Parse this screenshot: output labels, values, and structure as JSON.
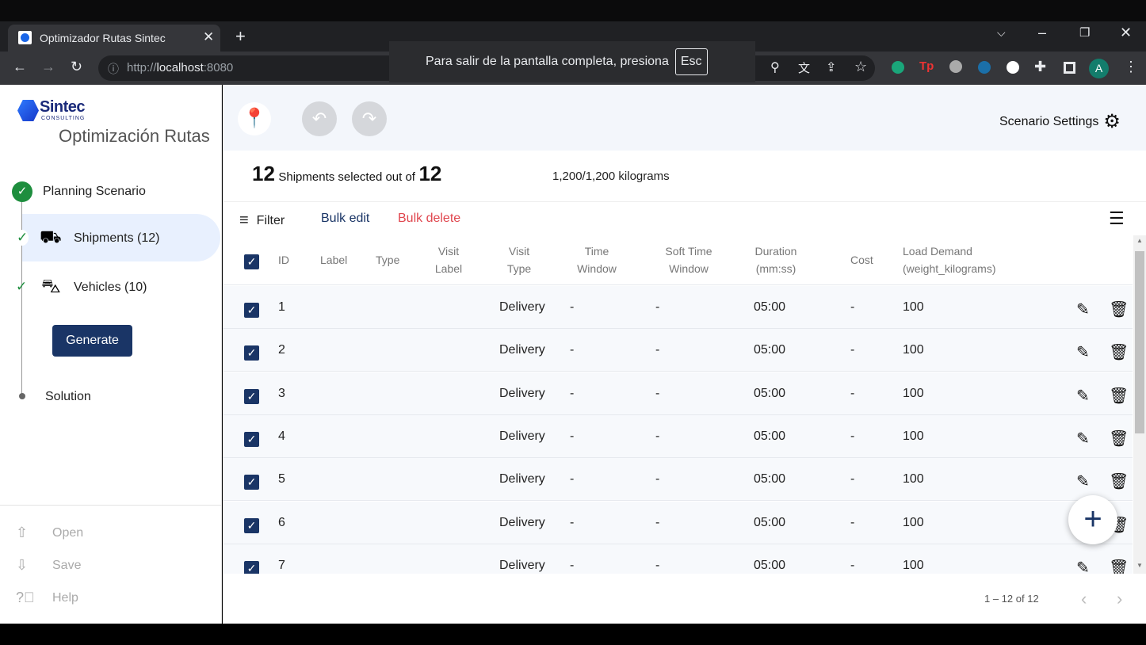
{
  "browser": {
    "tab_title": "Optimizador Rutas Sintec",
    "url_prefix": "http://",
    "url_host": "localhost",
    "url_port": ":8080",
    "fullscreen_note": "Para salir de la pantalla completa, presiona",
    "esc_key": "Esc",
    "profile_initial": "A"
  },
  "sidebar": {
    "brand": "Sintec",
    "brand_sub": "CONSULTING",
    "app_title": "Optimización Rutas",
    "steps": [
      {
        "label": "Planning Scenario"
      },
      {
        "label": "Shipments (12)"
      },
      {
        "label": "Vehicles (10)"
      },
      {
        "label": "Solution"
      }
    ],
    "generate": "Generate",
    "footer": [
      {
        "label": "Open"
      },
      {
        "label": "Save"
      },
      {
        "label": "Help"
      }
    ]
  },
  "header": {
    "scenario_settings": "Scenario Settings"
  },
  "summary": {
    "selected": "12",
    "selected_text": "Shipments selected out of",
    "total": "12",
    "weight": "1,200/1,200 kilograms"
  },
  "toolbar": {
    "filter": "Filter",
    "bulk_edit": "Bulk edit",
    "bulk_delete": "Bulk delete",
    "bulk_delete_color": "#e0474f"
  },
  "table": {
    "columns": [
      {
        "l1": "ID"
      },
      {
        "l1": "Label"
      },
      {
        "l1": "Type"
      },
      {
        "l1": "Visit",
        "l2": "Label"
      },
      {
        "l1": "Visit",
        "l2": "Type"
      },
      {
        "l1": "Time",
        "l2": "Window"
      },
      {
        "l1": "Soft Time",
        "l2": "Window"
      },
      {
        "l1": "Duration",
        "l2": "(mm:ss)"
      },
      {
        "l1": "Cost"
      },
      {
        "l1": "Load Demand",
        "l2": "(weight_kilograms)"
      }
    ],
    "rows": [
      {
        "id": "1",
        "visit_type": "Delivery",
        "tw": "-",
        "stw": "-",
        "duration": "05:00",
        "cost": "-",
        "load": "100"
      },
      {
        "id": "2",
        "visit_type": "Delivery",
        "tw": "-",
        "stw": "-",
        "duration": "05:00",
        "cost": "-",
        "load": "100"
      },
      {
        "id": "3",
        "visit_type": "Delivery",
        "tw": "-",
        "stw": "-",
        "duration": "05:00",
        "cost": "-",
        "load": "100"
      },
      {
        "id": "4",
        "visit_type": "Delivery",
        "tw": "-",
        "stw": "-",
        "duration": "05:00",
        "cost": "-",
        "load": "100"
      },
      {
        "id": "5",
        "visit_type": "Delivery",
        "tw": "-",
        "stw": "-",
        "duration": "05:00",
        "cost": "-",
        "load": "100"
      },
      {
        "id": "6",
        "visit_type": "Delivery",
        "tw": "-",
        "stw": "-",
        "duration": "05:00",
        "cost": "-",
        "load": "100"
      },
      {
        "id": "7",
        "visit_type": "Delivery",
        "tw": "-",
        "stw": "-",
        "duration": "05:00",
        "cost": "-",
        "load": "100"
      }
    ]
  },
  "pagination": {
    "range": "1 – 12 of 12"
  },
  "colors": {
    "primary": "#1a3566",
    "success": "#1e8e3e",
    "active_bg": "#e8f0fe"
  }
}
